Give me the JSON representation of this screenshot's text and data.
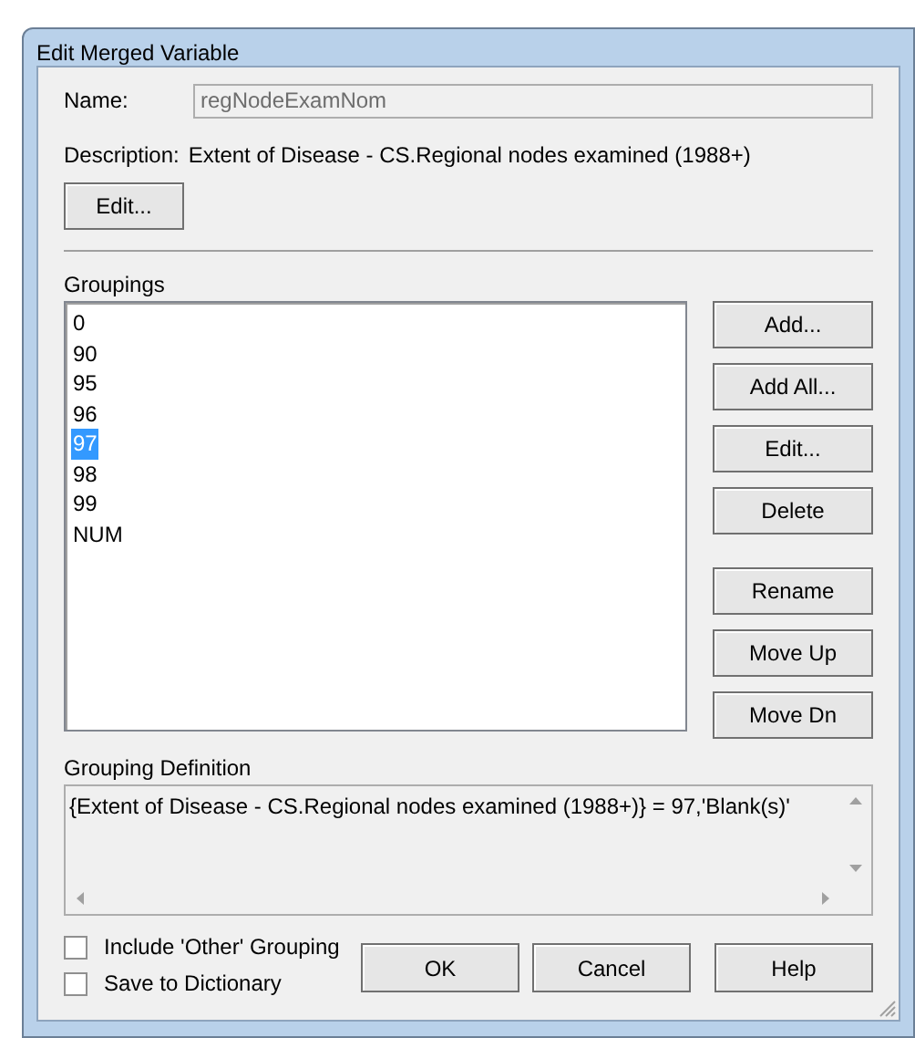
{
  "window": {
    "title": "Edit Merged Variable"
  },
  "name_field": {
    "label": "Name:",
    "value": "regNodeExamNom",
    "disabled": true
  },
  "description": {
    "label": "Description:",
    "value": "Extent of Disease - CS.Regional nodes examined (1988+)"
  },
  "description_edit_button": "Edit...",
  "groupings": {
    "label": "Groupings",
    "items": [
      {
        "label": "0",
        "selected": false
      },
      {
        "label": "90",
        "selected": false
      },
      {
        "label": "95",
        "selected": false
      },
      {
        "label": "96",
        "selected": false
      },
      {
        "label": "97",
        "selected": true
      },
      {
        "label": "98",
        "selected": false
      },
      {
        "label": "99",
        "selected": false
      },
      {
        "label": "NUM",
        "selected": false
      }
    ]
  },
  "side_button_groups": [
    [
      "Add...",
      "Add All...",
      "Edit...",
      "Delete"
    ],
    [
      "Rename",
      "Move Up",
      "Move Dn"
    ]
  ],
  "grouping_definition": {
    "label": "Grouping Definition",
    "value": "{Extent of Disease - CS.Regional nodes examined (1988+)} = 97,'Blank(s)'"
  },
  "checkboxes": [
    {
      "label": "Include 'Other' Grouping",
      "checked": false
    },
    {
      "label": "Save to Dictionary",
      "checked": false
    }
  ],
  "buttons": [
    "OK",
    "Cancel",
    "Help"
  ]
}
